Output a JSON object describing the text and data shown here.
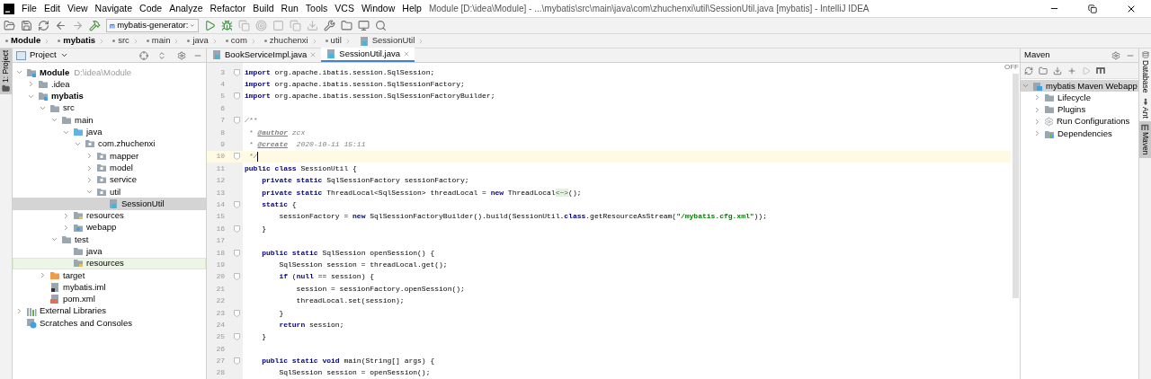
{
  "window": {
    "title": "Module [D:\\idea\\Module] - ...\\mybatis\\src\\main\\java\\com\\zhuchenxi\\util\\SessionUtil.java [mybatis] - IntelliJ IDEA"
  },
  "menu": [
    "File",
    "Edit",
    "View",
    "Navigate",
    "Code",
    "Analyze",
    "Refactor",
    "Build",
    "Run",
    "Tools",
    "VCS",
    "Window",
    "Help"
  ],
  "toolbar": {
    "run_configuration": "mybatis-generator:"
  },
  "breadcrumbs": [
    {
      "label": "Module",
      "kind": "module"
    },
    {
      "label": "mybatis",
      "kind": "module"
    },
    {
      "label": "src",
      "kind": "dir"
    },
    {
      "label": "main",
      "kind": "dir"
    },
    {
      "label": "java",
      "kind": "dir"
    },
    {
      "label": "com",
      "kind": "dir"
    },
    {
      "label": "zhuchenxi",
      "kind": "dir"
    },
    {
      "label": "util",
      "kind": "dir"
    },
    {
      "label": "SessionUtil",
      "kind": "class"
    }
  ],
  "left_stripe": [
    {
      "label": "1: Project",
      "selected": true
    }
  ],
  "project_panel": {
    "title": "Project",
    "tree": [
      {
        "label": "Module",
        "path": "D:\\idea\\Module",
        "kind": "module",
        "expanded": true,
        "selected": false,
        "hovered": false,
        "children": [
          {
            "label": ".idea",
            "kind": "folder",
            "expanded": false,
            "selected": false,
            "hovered": false
          },
          {
            "label": "mybatis",
            "kind": "module",
            "expanded": true,
            "selected": false,
            "hovered": false,
            "children": [
              {
                "label": "src",
                "kind": "folder",
                "expanded": true,
                "selected": false,
                "hovered": false,
                "children": [
                  {
                    "label": "main",
                    "kind": "folder",
                    "expanded": true,
                    "selected": false,
                    "hovered": false,
                    "children": [
                      {
                        "label": "java",
                        "kind": "source",
                        "expanded": true,
                        "selected": false,
                        "hovered": false,
                        "children": [
                          {
                            "label": "com.zhuchenxi",
                            "kind": "package",
                            "expanded": true,
                            "selected": false,
                            "hovered": false,
                            "children": [
                              {
                                "label": "mapper",
                                "kind": "package",
                                "expanded": false,
                                "selected": false,
                                "hovered": false
                              },
                              {
                                "label": "model",
                                "kind": "package",
                                "expanded": false,
                                "selected": false,
                                "hovered": false
                              },
                              {
                                "label": "service",
                                "kind": "package",
                                "expanded": false,
                                "selected": false,
                                "hovered": false
                              },
                              {
                                "label": "util",
                                "kind": "package",
                                "expanded": true,
                                "selected": false,
                                "hovered": false,
                                "children": [
                                  {
                                    "label": "SessionUtil",
                                    "kind": "class",
                                    "selected": true,
                                    "hovered": false
                                  }
                                ]
                              }
                            ]
                          }
                        ]
                      },
                      {
                        "label": "resources",
                        "kind": "resources",
                        "expanded": false,
                        "selected": false,
                        "hovered": false
                      },
                      {
                        "label": "webapp",
                        "kind": "web",
                        "expanded": false,
                        "selected": false,
                        "hovered": false
                      }
                    ]
                  },
                  {
                    "label": "test",
                    "kind": "folder",
                    "expanded": true,
                    "selected": false,
                    "hovered": false,
                    "children": [
                      {
                        "label": "java",
                        "kind": "folder",
                        "selected": false,
                        "hovered": false
                      },
                      {
                        "label": "resources",
                        "kind": "resources",
                        "selected": false,
                        "hovered": true
                      }
                    ]
                  }
                ]
              },
              {
                "label": "target",
                "kind": "excluded",
                "expanded": false,
                "selected": false,
                "hovered": false
              },
              {
                "label": "mybatis.iml",
                "kind": "iml",
                "selected": false,
                "hovered": false
              },
              {
                "label": "pom.xml",
                "kind": "xml",
                "selected": false,
                "hovered": false
              }
            ]
          }
        ]
      },
      {
        "label": "External Libraries",
        "kind": "libraries",
        "expanded": false,
        "selected": false,
        "hovered": false
      },
      {
        "label": "Scratches and Consoles",
        "kind": "scratches",
        "selected": false,
        "hovered": false
      }
    ]
  },
  "editor": {
    "tabs": [
      {
        "label": "BookServiceImpl.java",
        "selected": false
      },
      {
        "label": "SessionUtil.java",
        "selected": true
      }
    ],
    "mode_label": "OFF",
    "lines": [
      {
        "number": "3",
        "fold": true,
        "current": false,
        "tokens": [
          {
            "kind": "kw",
            "t": "import"
          },
          {
            "kind": "plain",
            "t": " org.apache.ibatis.session.SqlSession;"
          }
        ]
      },
      {
        "number": "4",
        "fold": false,
        "current": false,
        "tokens": [
          {
            "kind": "kw",
            "t": "import"
          },
          {
            "kind": "plain",
            "t": " org.apache.ibatis.session.SqlSessionFactory;"
          }
        ]
      },
      {
        "number": "5",
        "fold": true,
        "current": false,
        "tokens": [
          {
            "kind": "kw",
            "t": "import"
          },
          {
            "kind": "plain",
            "t": " org.apache.ibatis.session.SqlSessionFactoryBuilder;"
          }
        ]
      },
      {
        "number": "6",
        "fold": false,
        "current": false
      },
      {
        "number": "7",
        "fold": true,
        "current": false,
        "tokens": [
          {
            "kind": "comment",
            "t": "/**"
          }
        ]
      },
      {
        "number": "8",
        "fold": false,
        "current": false,
        "tokens": [
          {
            "kind": "comment",
            "t": " * "
          },
          {
            "kind": "tag",
            "t": "@author"
          },
          {
            "kind": "comment",
            "t": " zcx"
          }
        ]
      },
      {
        "number": "9",
        "fold": false,
        "current": false,
        "tokens": [
          {
            "kind": "comment",
            "t": " * "
          },
          {
            "kind": "tag",
            "t": "@create"
          },
          {
            "kind": "comment",
            "t": "  2020-10-11 15:11"
          }
        ]
      },
      {
        "number": "10",
        "fold": true,
        "current": true,
        "tokens": [
          {
            "kind": "comment",
            "t": " */"
          }
        ]
      },
      {
        "number": "11",
        "fold": false,
        "current": false,
        "tokens": [
          {
            "kind": "kw",
            "t": "public class"
          },
          {
            "kind": "plain",
            "t": " SessionUtil {"
          }
        ]
      },
      {
        "number": "12",
        "fold": false,
        "current": false,
        "tokens": [
          {
            "kind": "kw",
            "t": "    private static"
          },
          {
            "kind": "plain",
            "t": " SqlSessionFactory sessionFactory;"
          }
        ]
      },
      {
        "number": "13",
        "fold": false,
        "current": false,
        "tokens": [
          {
            "kind": "kw",
            "t": "    private static"
          },
          {
            "kind": "plain",
            "t": " ThreadLocal<SqlSession> threadLocal = "
          },
          {
            "kind": "kw",
            "t": "new"
          },
          {
            "kind": "plain",
            "t": " ThreadLocal"
          },
          {
            "kind": "hint",
            "t": "<~>"
          },
          {
            "kind": "plain",
            "t": "();"
          }
        ]
      },
      {
        "number": "14",
        "fold": true,
        "current": false,
        "tokens": [
          {
            "kind": "kw",
            "t": "    static"
          },
          {
            "kind": "plain",
            "t": " {"
          }
        ]
      },
      {
        "number": "15",
        "fold": false,
        "current": false,
        "tokens": [
          {
            "kind": "plain",
            "t": "        sessionFactory = "
          },
          {
            "kind": "kw",
            "t": "new"
          },
          {
            "kind": "plain",
            "t": " SqlSessionFactoryBuilder().build(SessionUtil."
          },
          {
            "kind": "kw",
            "t": "class"
          },
          {
            "kind": "plain",
            "t": ".getResourceAsStream("
          },
          {
            "kind": "str",
            "t": "\"/mybatis.cfg.xml\""
          },
          {
            "kind": "plain",
            "t": "));"
          }
        ]
      },
      {
        "number": "16",
        "fold": true,
        "current": false,
        "tokens": [
          {
            "kind": "plain",
            "t": "    }"
          }
        ]
      },
      {
        "number": "17",
        "fold": false,
        "current": false
      },
      {
        "number": "18",
        "fold": true,
        "current": false,
        "tokens": [
          {
            "kind": "kw",
            "t": "    public static"
          },
          {
            "kind": "plain",
            "t": " SqlSession openSession() {"
          }
        ]
      },
      {
        "number": "19",
        "fold": false,
        "current": false,
        "tokens": [
          {
            "kind": "plain",
            "t": "        SqlSession session = threadLocal.get();"
          }
        ]
      },
      {
        "number": "20",
        "fold": true,
        "current": false,
        "tokens": [
          {
            "kind": "kw",
            "t": "        if"
          },
          {
            "kind": "plain",
            "t": " ("
          },
          {
            "kind": "kw",
            "t": "null"
          },
          {
            "kind": "plain",
            "t": " == session) {"
          }
        ]
      },
      {
        "number": "21",
        "fold": false,
        "current": false,
        "tokens": [
          {
            "kind": "plain",
            "t": "            session = sessionFactory.openSession();"
          }
        ]
      },
      {
        "number": "22",
        "fold": false,
        "current": false,
        "tokens": [
          {
            "kind": "plain",
            "t": "            threadLocal.set(session);"
          }
        ]
      },
      {
        "number": "23",
        "fold": true,
        "current": false,
        "tokens": [
          {
            "kind": "plain",
            "t": "        }"
          }
        ]
      },
      {
        "number": "24",
        "fold": false,
        "current": false,
        "tokens": [
          {
            "kind": "kw",
            "t": "        return"
          },
          {
            "kind": "plain",
            "t": " session;"
          }
        ]
      },
      {
        "number": "25",
        "fold": true,
        "current": false,
        "tokens": [
          {
            "kind": "plain",
            "t": "    }"
          }
        ]
      },
      {
        "number": "26",
        "fold": false,
        "current": false
      },
      {
        "number": "27",
        "fold": true,
        "current": false,
        "tokens": [
          {
            "kind": "kw",
            "t": "    public static void"
          },
          {
            "kind": "plain",
            "t": " main(String[] args) {"
          }
        ]
      },
      {
        "number": "28",
        "fold": false,
        "current": false,
        "tokens": [
          {
            "kind": "plain",
            "t": "        SqlSession session = openSession();"
          }
        ]
      }
    ]
  },
  "maven_panel": {
    "title": "Maven",
    "tree": [
      {
        "label": "mybatis Maven Webapp",
        "kind": "project",
        "expanded": true,
        "selected": true,
        "children": [
          {
            "label": "Lifecycle",
            "kind": "folder",
            "expanded": false,
            "selected": false
          },
          {
            "label": "Plugins",
            "kind": "folder",
            "expanded": false,
            "selected": false
          },
          {
            "label": "Run Configurations",
            "kind": "gear",
            "expanded": false,
            "selected": false
          },
          {
            "label": "Dependencies",
            "kind": "deps",
            "expanded": false,
            "selected": false
          }
        ]
      }
    ]
  },
  "right_stripe": [
    {
      "label": "Database",
      "kind": "database",
      "selected": false
    },
    {
      "label": "Ant",
      "kind": "ant",
      "selected": false
    },
    {
      "label": "Maven",
      "kind": "maven",
      "selected": true
    }
  ]
}
